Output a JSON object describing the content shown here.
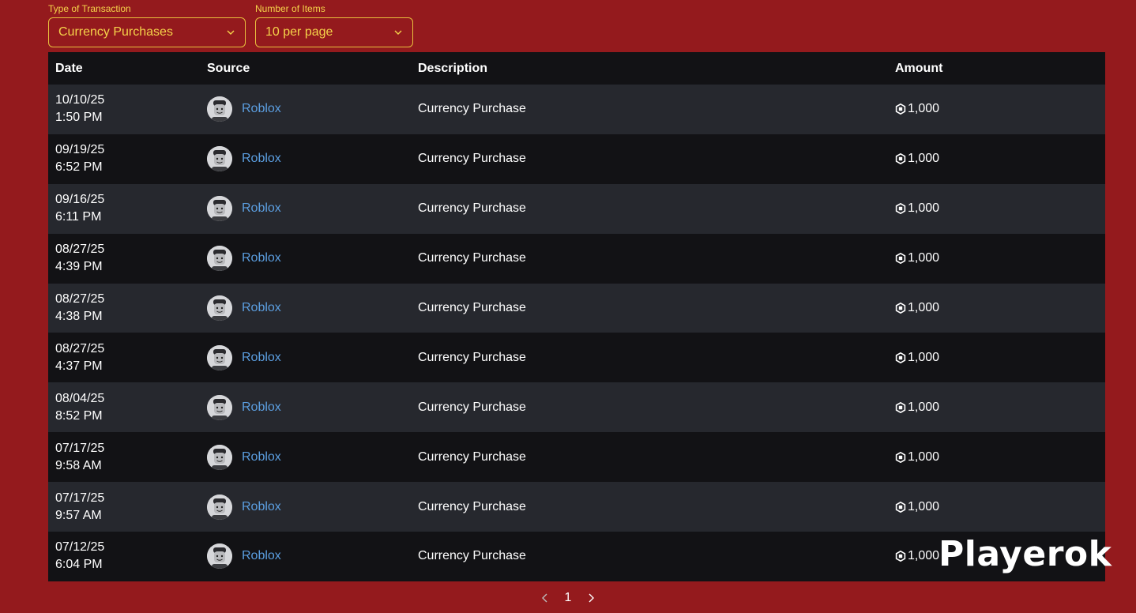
{
  "filters": {
    "type_label": "Type of Transaction",
    "type_value": "Currency Purchases",
    "count_label": "Number of Items",
    "count_value": "10 per page"
  },
  "table": {
    "headers": {
      "date": "Date",
      "source": "Source",
      "description": "Description",
      "amount": "Amount"
    },
    "rows": [
      {
        "date": "10/10/25",
        "time": "1:50 PM",
        "source": "Roblox",
        "description": "Currency Purchase",
        "amount": "1,000"
      },
      {
        "date": "09/19/25",
        "time": "6:52 PM",
        "source": "Roblox",
        "description": "Currency Purchase",
        "amount": "1,000"
      },
      {
        "date": "09/16/25",
        "time": "6:11 PM",
        "source": "Roblox",
        "description": "Currency Purchase",
        "amount": "1,000"
      },
      {
        "date": "08/27/25",
        "time": "4:39 PM",
        "source": "Roblox",
        "description": "Currency Purchase",
        "amount": "1,000"
      },
      {
        "date": "08/27/25",
        "time": "4:38 PM",
        "source": "Roblox",
        "description": "Currency Purchase",
        "amount": "1,000"
      },
      {
        "date": "08/27/25",
        "time": "4:37 PM",
        "source": "Roblox",
        "description": "Currency Purchase",
        "amount": "1,000"
      },
      {
        "date": "08/04/25",
        "time": "8:52 PM",
        "source": "Roblox",
        "description": "Currency Purchase",
        "amount": "1,000"
      },
      {
        "date": "07/17/25",
        "time": "9:58 AM",
        "source": "Roblox",
        "description": "Currency Purchase",
        "amount": "1,000"
      },
      {
        "date": "07/17/25",
        "time": "9:57 AM",
        "source": "Roblox",
        "description": "Currency Purchase",
        "amount": "1,000"
      },
      {
        "date": "07/12/25",
        "time": "6:04 PM",
        "source": "Roblox",
        "description": "Currency Purchase",
        "amount": "1,000"
      }
    ]
  },
  "pagination": {
    "current_page": "1"
  },
  "watermark": "Playerok",
  "colors": {
    "background": "#941a1d",
    "accent": "#f5d34a",
    "link": "#5b9ee0",
    "row_light": "#26282e",
    "row_dark": "#121215"
  },
  "icons": {
    "dropdown": "chevron-down-icon",
    "currency": "robux-icon",
    "avatar": "avatar-icon",
    "prev": "chevron-left-icon",
    "next": "chevron-right-icon"
  }
}
